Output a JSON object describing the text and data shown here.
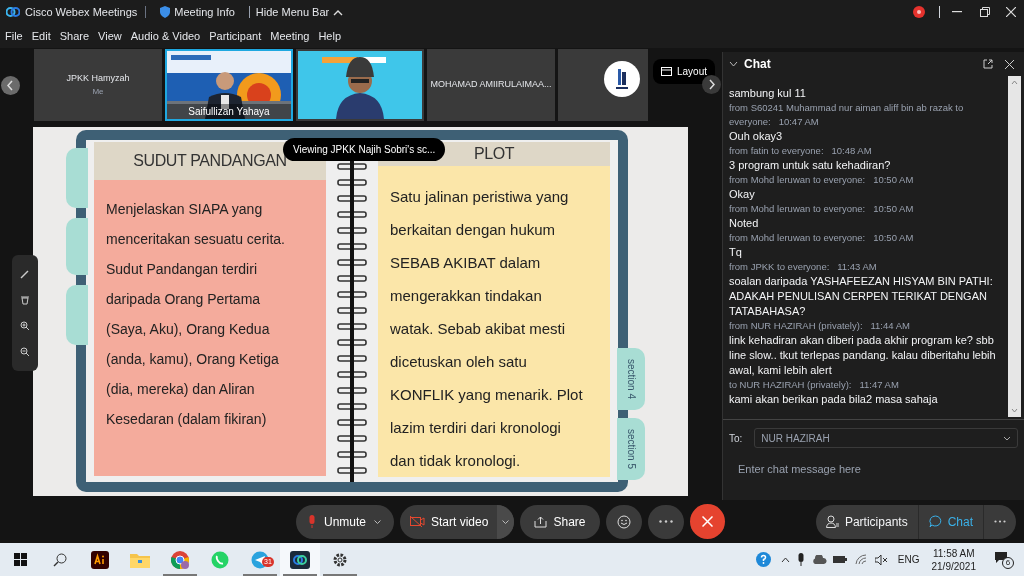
{
  "title_bar": {
    "app": "Cisco Webex Meetings",
    "meeting_info": "Meeting Info",
    "hide_menu": "Hide Menu Bar"
  },
  "menu": [
    "File",
    "Edit",
    "Share",
    "View",
    "Audio & Video",
    "Participant",
    "Meeting",
    "Help"
  ],
  "thumbnails": [
    {
      "kind": "name",
      "name": "JPKK Hamyzah",
      "subtitle": "Me",
      "selected": false
    },
    {
      "kind": "video",
      "name": "Saifullizan Yahaya",
      "selected": true
    },
    {
      "kind": "video",
      "selected": false
    },
    {
      "kind": "name",
      "name": "MOHAMAD AMIIRULAIMAA...",
      "selected": false
    },
    {
      "kind": "logo",
      "selected": false
    }
  ],
  "layout_button": "Layout",
  "share_banner": "Viewing JPKK Najih Sobri's sc...",
  "slide": {
    "left_title": "SUDUT PANDANGAN",
    "left_text": "Menjelaskan SIAPA yang\nmenceritakan sesuatu cerita.\nSudut Pandangan terdiri\ndaripada Orang Pertama\n(Saya, Aku), Orang Kedua\n(anda, kamu), Orang Ketiga\n(dia, mereka) dan Aliran\nKesedaran (dalam fikiran)",
    "right_title": "PLOT",
    "right_text": "Satu jalinan peristiwa yang\nberkaitan dengan hukum\nSEBAB AKIBAT dalam\nmengerakkan tindakan\nwatak. Sebab akibat mesti\ndicetuskan oleh satu\nKONFLIK yang menarik. Plot\nlazim terdiri dari kronologi\ndan tidak kronologi.",
    "section_tabs": [
      "section 4",
      "section 5"
    ]
  },
  "chat": {
    "title": "Chat",
    "messages": [
      {
        "text": "sambung kul 11"
      },
      {
        "meta": "from S60241 Muhammad nur aiman aliff bin ab razak to everyone:",
        "time": "10:47 AM",
        "text": "Ouh okay3"
      },
      {
        "meta": "from fatin to everyone:",
        "time": "10:48 AM",
        "text": "3 program untuk satu kehadiran?"
      },
      {
        "meta": "from Mohd leruwan  to everyone:",
        "time": "10:50 AM",
        "text": "Okay"
      },
      {
        "meta": "from Mohd leruwan  to everyone:",
        "time": "10:50 AM",
        "text": "Noted"
      },
      {
        "meta": "from Mohd leruwan  to everyone:",
        "time": "10:50 AM",
        "text": "Tq"
      },
      {
        "meta": "from JPKK to everyone:",
        "time": "11:43 AM",
        "text": "soalan daripada YASHAFEEZAN HISYAM BIN PATHI: ADAKAH PENULISAN CERPEN TERIKAT DENGAN TATABAHASA?"
      },
      {
        "meta": "from NUR HAZIRAH (privately):",
        "time": "11:44 AM",
        "text": "link kehadiran akan diberi pada akhir program ke? sbb line slow.. tkut terlepas pandang. kalau diberitahu lebih awal, kami lebih alert"
      },
      {
        "meta": "to NUR HAZIRAH (privately):",
        "time": "11:47 AM",
        "text": "kami akan berikan pada bila2 masa sahaja"
      }
    ],
    "to_label": "To:",
    "recipient": "NUR HAZIRAH",
    "placeholder": "Enter chat message here"
  },
  "controls": [
    {
      "kind": "mute",
      "label": "Unmute"
    },
    {
      "kind": "video",
      "label": "Start video"
    },
    {
      "kind": "share",
      "label": "Share"
    },
    {
      "kind": "reaction"
    },
    {
      "kind": "more"
    },
    {
      "kind": "end"
    }
  ],
  "panels": [
    {
      "kind": "participants",
      "label": "Participants",
      "selected": false
    },
    {
      "kind": "chat",
      "label": "Chat",
      "selected": true
    }
  ],
  "taskbar": {
    "apps": [
      {
        "kind": "start",
        "running": false
      },
      {
        "kind": "search",
        "running": false
      },
      {
        "kind": "illustrator",
        "running": false
      },
      {
        "kind": "folder",
        "running": false
      },
      {
        "kind": "chrome",
        "running": true
      },
      {
        "kind": "whatsapp",
        "running": false
      },
      {
        "kind": "telegram",
        "running": true,
        "badge": "31"
      },
      {
        "kind": "webex",
        "running": true
      },
      {
        "kind": "settings",
        "running": true
      }
    ],
    "language": "ENG",
    "time": "11:58 AM",
    "date": "21/9/2021",
    "notifications": "6"
  }
}
